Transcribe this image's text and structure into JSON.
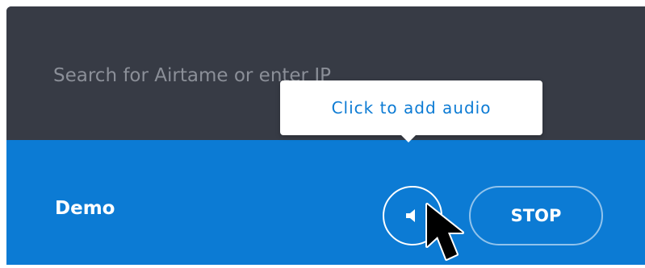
{
  "search": {
    "placeholder": "Search for Airtame or enter IP"
  },
  "tooltip": {
    "text": "Click to add audio"
  },
  "device": {
    "name": "Demo",
    "audio_icon": "speaker-icon",
    "stop_label": "STOP"
  },
  "colors": {
    "header_bg": "#373b45",
    "accent_blue": "#0c7bd4",
    "placeholder_text": "#8b8f98",
    "white": "#ffffff"
  }
}
